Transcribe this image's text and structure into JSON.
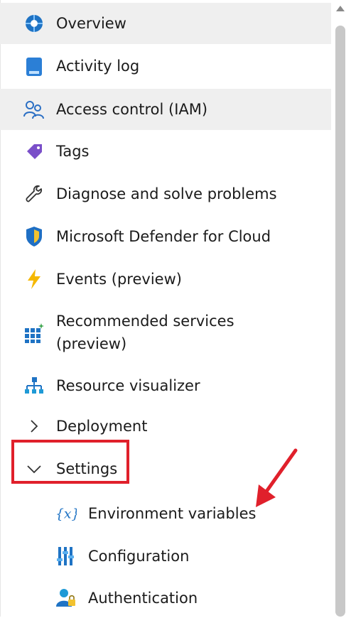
{
  "menu": {
    "items": [
      {
        "label": "Overview",
        "icon": "overview-icon"
      },
      {
        "label": "Activity log",
        "icon": "activity-log-icon"
      },
      {
        "label": "Access control (IAM)",
        "icon": "access-control-icon"
      },
      {
        "label": "Tags",
        "icon": "tag-icon"
      },
      {
        "label": "Diagnose and solve problems",
        "icon": "wrench-icon"
      },
      {
        "label": "Microsoft Defender for Cloud",
        "icon": "shield-icon"
      },
      {
        "label": "Events (preview)",
        "icon": "lightning-icon"
      },
      {
        "label": "Recommended services\n(preview)",
        "icon": "grid-icon"
      },
      {
        "label": "Resource visualizer",
        "icon": "hierarchy-icon"
      }
    ],
    "groups": {
      "deployment": {
        "label": "Deployment",
        "icon": "chevron-right-icon"
      },
      "settings": {
        "label": "Settings",
        "icon": "chevron-down-icon"
      }
    },
    "settings_items": [
      {
        "label": "Environment variables",
        "icon": "variable-icon"
      },
      {
        "label": "Configuration",
        "icon": "configuration-icon"
      },
      {
        "label": "Authentication",
        "icon": "user-lock-icon"
      }
    ]
  },
  "colors": {
    "selected_background": "#efefef",
    "highlight_box": "#e0202b",
    "accent_blue": "#0078d4"
  }
}
